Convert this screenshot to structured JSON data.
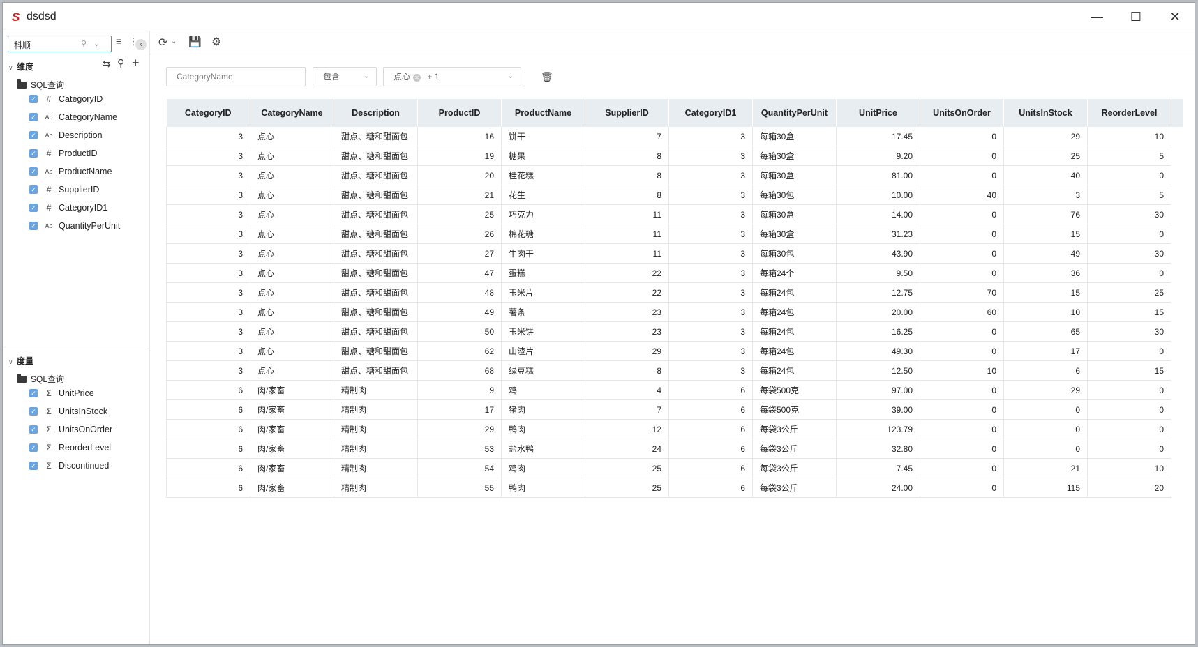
{
  "window": {
    "logo": "S",
    "title": "dsdsd"
  },
  "sidebar": {
    "search": {
      "value": "科顺",
      "placeholder": ""
    },
    "dimensions": {
      "label": "维度",
      "folder": "SQL查询",
      "fields": [
        {
          "type": "#",
          "name": "CategoryID"
        },
        {
          "type": "Ab",
          "name": "CategoryName"
        },
        {
          "type": "Ab",
          "name": "Description"
        },
        {
          "type": "#",
          "name": "ProductID"
        },
        {
          "type": "Ab",
          "name": "ProductName"
        },
        {
          "type": "#",
          "name": "SupplierID"
        },
        {
          "type": "#",
          "name": "CategoryID1"
        },
        {
          "type": "Ab",
          "name": "QuantityPerUnit"
        }
      ]
    },
    "measures": {
      "label": "度量",
      "folder": "SQL查询",
      "fields": [
        {
          "type": "Σ",
          "name": "UnitPrice"
        },
        {
          "type": "Σ",
          "name": "UnitsInStock"
        },
        {
          "type": "Σ",
          "name": "UnitsOnOrder"
        },
        {
          "type": "Σ",
          "name": "ReorderLevel"
        },
        {
          "type": "Σ",
          "name": "Discontinued"
        }
      ]
    }
  },
  "filter": {
    "field_placeholder": "CategoryName",
    "operator": "包含",
    "value_tag": "点心",
    "more_count": "+ 1"
  },
  "table": {
    "columns": [
      "CategoryID",
      "CategoryName",
      "Description",
      "ProductID",
      "ProductName",
      "SupplierID",
      "CategoryID1",
      "QuantityPerUnit",
      "UnitPrice",
      "UnitsOnOrder",
      "UnitsInStock",
      "ReorderLevel"
    ],
    "rows": [
      [
        "3",
        "点心",
        "甜点、糖和甜面包",
        "16",
        "饼干",
        "7",
        "3",
        "每箱30盒",
        "17.45",
        "0",
        "29",
        "10"
      ],
      [
        "3",
        "点心",
        "甜点、糖和甜面包",
        "19",
        "糖果",
        "8",
        "3",
        "每箱30盒",
        "9.20",
        "0",
        "25",
        "5"
      ],
      [
        "3",
        "点心",
        "甜点、糖和甜面包",
        "20",
        "桂花糕",
        "8",
        "3",
        "每箱30盒",
        "81.00",
        "0",
        "40",
        "0"
      ],
      [
        "3",
        "点心",
        "甜点、糖和甜面包",
        "21",
        "花生",
        "8",
        "3",
        "每箱30包",
        "10.00",
        "40",
        "3",
        "5"
      ],
      [
        "3",
        "点心",
        "甜点、糖和甜面包",
        "25",
        "巧克力",
        "11",
        "3",
        "每箱30盒",
        "14.00",
        "0",
        "76",
        "30"
      ],
      [
        "3",
        "点心",
        "甜点、糖和甜面包",
        "26",
        "棉花糖",
        "11",
        "3",
        "每箱30盒",
        "31.23",
        "0",
        "15",
        "0"
      ],
      [
        "3",
        "点心",
        "甜点、糖和甜面包",
        "27",
        "牛肉干",
        "11",
        "3",
        "每箱30包",
        "43.90",
        "0",
        "49",
        "30"
      ],
      [
        "3",
        "点心",
        "甜点、糖和甜面包",
        "47",
        "蛋糕",
        "22",
        "3",
        "每箱24个",
        "9.50",
        "0",
        "36",
        "0"
      ],
      [
        "3",
        "点心",
        "甜点、糖和甜面包",
        "48",
        "玉米片",
        "22",
        "3",
        "每箱24包",
        "12.75",
        "70",
        "15",
        "25"
      ],
      [
        "3",
        "点心",
        "甜点、糖和甜面包",
        "49",
        "薯条",
        "23",
        "3",
        "每箱24包",
        "20.00",
        "60",
        "10",
        "15"
      ],
      [
        "3",
        "点心",
        "甜点、糖和甜面包",
        "50",
        "玉米饼",
        "23",
        "3",
        "每箱24包",
        "16.25",
        "0",
        "65",
        "30"
      ],
      [
        "3",
        "点心",
        "甜点、糖和甜面包",
        "62",
        "山渣片",
        "29",
        "3",
        "每箱24包",
        "49.30",
        "0",
        "17",
        "0"
      ],
      [
        "3",
        "点心",
        "甜点、糖和甜面包",
        "68",
        "绿豆糕",
        "8",
        "3",
        "每箱24包",
        "12.50",
        "10",
        "6",
        "15"
      ],
      [
        "6",
        "肉/家畜",
        "精制肉",
        "9",
        "鸡",
        "4",
        "6",
        "每袋500克",
        "97.00",
        "0",
        "29",
        "0"
      ],
      [
        "6",
        "肉/家畜",
        "精制肉",
        "17",
        "猪肉",
        "7",
        "6",
        "每袋500克",
        "39.00",
        "0",
        "0",
        "0"
      ],
      [
        "6",
        "肉/家畜",
        "精制肉",
        "29",
        "鸭肉",
        "12",
        "6",
        "每袋3公斤",
        "123.79",
        "0",
        "0",
        "0"
      ],
      [
        "6",
        "肉/家畜",
        "精制肉",
        "53",
        "盐水鸭",
        "24",
        "6",
        "每袋3公斤",
        "32.80",
        "0",
        "0",
        "0"
      ],
      [
        "6",
        "肉/家畜",
        "精制肉",
        "54",
        "鸡肉",
        "25",
        "6",
        "每袋3公斤",
        "7.45",
        "0",
        "21",
        "10"
      ],
      [
        "6",
        "肉/家畜",
        "精制肉",
        "55",
        "鸭肉",
        "25",
        "6",
        "每袋3公斤",
        "24.00",
        "0",
        "115",
        "20"
      ]
    ]
  }
}
